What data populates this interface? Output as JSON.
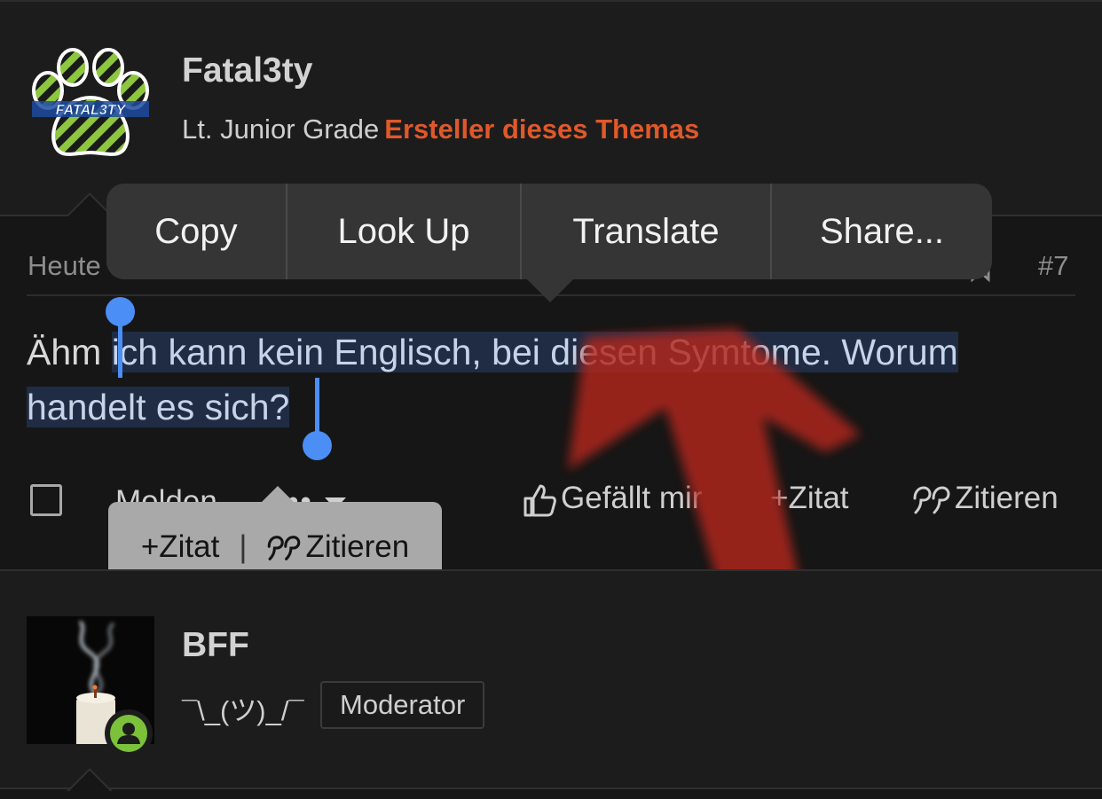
{
  "post1": {
    "username": "Fatal3ty",
    "avatar_text": "FATAL3TY",
    "rank": "Lt. Junior Grade",
    "op_label": "Ersteller dieses Themas",
    "date_prefix": "Heute",
    "post_number": "#7",
    "text_before": "Ähm ",
    "text_selected": "ich kann kein Englisch, bei diesen Symtome. Worum handelt es sich?",
    "actions": {
      "report": "Melden",
      "more": "•••",
      "like": "Gefällt mir",
      "multiquote": "Zitat",
      "quote": "Zitieren"
    }
  },
  "context_menu": {
    "items": [
      "Copy",
      "Look Up",
      "Translate",
      "Share..."
    ]
  },
  "quote_popup": {
    "multiquote": "Zitat",
    "separator": "|",
    "quote": "Zitieren"
  },
  "post2": {
    "username": "BFF",
    "tagline": "¯\\_(ツ)_/¯",
    "badge": "Moderator",
    "online_icon": "user-online-icon"
  },
  "colors": {
    "accent_orange": "#e0582a",
    "selection_handle": "#4b8ef5",
    "selection_bg": "#1f2c44",
    "online_green": "#7cc13a"
  }
}
